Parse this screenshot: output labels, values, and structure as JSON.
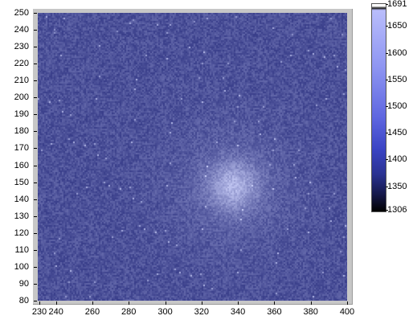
{
  "chart_data": {
    "type": "heatmap",
    "xlim": [
      230,
      400
    ],
    "ylim": [
      80,
      250
    ],
    "x_ticks": [
      "230",
      "240",
      "260",
      "280",
      "300",
      "320",
      "340",
      "360",
      "380",
      "400"
    ],
    "y_ticks": [
      "80",
      "90",
      "100",
      "110",
      "120",
      "130",
      "140",
      "150",
      "160",
      "170",
      "180",
      "190",
      "200",
      "210",
      "220",
      "230",
      "240",
      "250"
    ],
    "colorbar": {
      "min": 1306,
      "max": 1691,
      "labels": [
        "1691",
        "1650",
        "1600",
        "1550",
        "1500",
        "1450",
        "1400",
        "1350",
        "1306"
      ],
      "label_values": [
        1691,
        1650,
        1600,
        1550,
        1500,
        1450,
        1400,
        1350,
        1306
      ]
    },
    "background_level": 1440,
    "bright_spot": {
      "center_x": 337,
      "center_y": 148,
      "peak_value": 1560
    },
    "colors": {
      "plot_background": "#2c3594",
      "frame": "#c7c7c7"
    }
  }
}
